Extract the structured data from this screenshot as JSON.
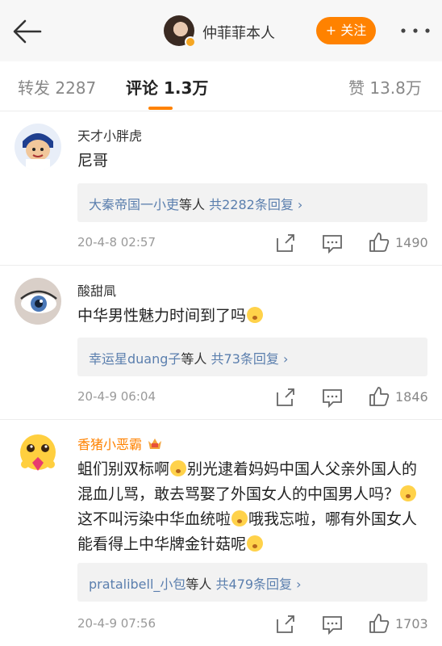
{
  "header": {
    "user_name": "仲菲菲本人",
    "follow_label": "+ 关注",
    "accent_color": "#ff8200"
  },
  "tabs": [
    {
      "label": "转发 2287",
      "active": false
    },
    {
      "label": "评论 1.3万",
      "active": true
    },
    {
      "label": "赞 13.8万",
      "active": false
    }
  ],
  "comments": [
    {
      "author": "天才小胖虎",
      "text": "尼哥",
      "reply_names": "大秦帝国一小吏",
      "reply_tail": "等人",
      "reply_count": "共2282条回复 ›",
      "time": "20-4-8 02:57",
      "likes": "1490"
    },
    {
      "author": "酸甜凬",
      "text": "中华男性魅力时间到了吗",
      "reply_names": "幸运星duang子",
      "reply_tail": "等人",
      "reply_count": "共73条回复 ›",
      "time": "20-4-9 06:04",
      "likes": "1846"
    },
    {
      "author": "香猪小恶霸",
      "text_parts": [
        "蛆们别双标啊",
        "别光逮着妈妈中国人父亲外国人的混血儿骂，敢去骂娶了外国女人的中国男人吗？",
        "这不叫污染中华血统啦",
        "哦我忘啦，哪有外国女人能看得上中华牌金针菇呢"
      ],
      "reply_names": "pratalibell_小包",
      "reply_tail": "等人",
      "reply_count": "共479条回复 ›",
      "time": "20-4-9 07:56",
      "likes": "1703"
    }
  ],
  "icons": [
    "back-arrow-icon",
    "more-dots-icon",
    "share-icon",
    "comment-icon",
    "like-icon",
    "emoji-icon",
    "crown-icon"
  ]
}
